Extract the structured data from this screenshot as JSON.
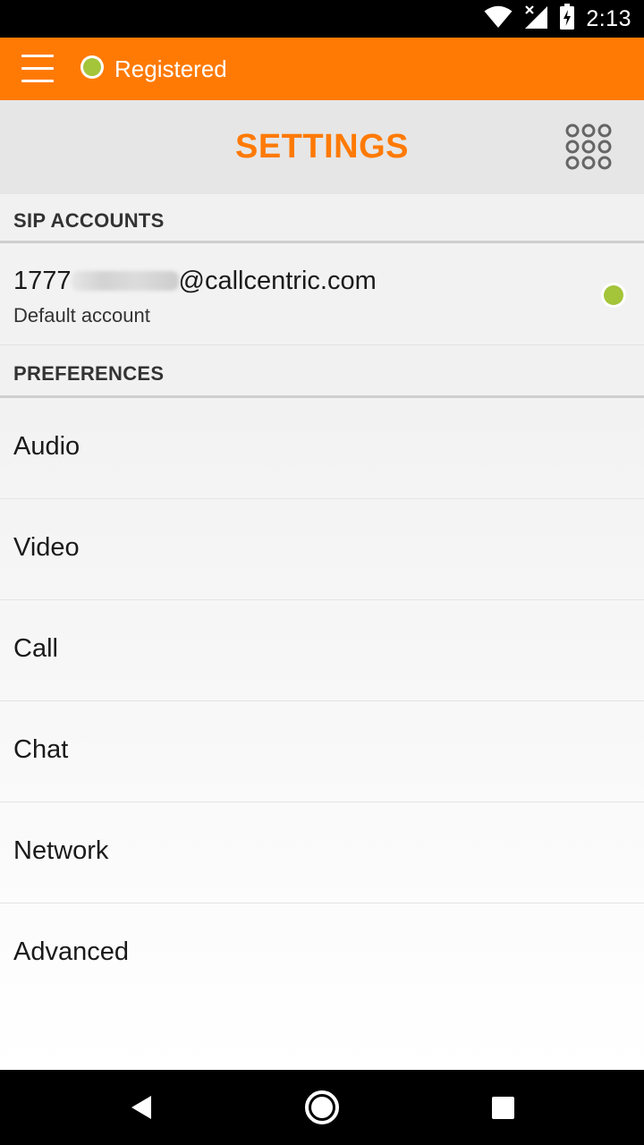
{
  "status_bar": {
    "time": "2:13",
    "icons": [
      "wifi-icon",
      "signal-no-data-icon",
      "battery-charging-icon"
    ]
  },
  "app_bar": {
    "menu_icon": "hamburger-menu-icon",
    "registration_status": "Registered",
    "status_color": "#a4c43a",
    "bar_color": "#ff7a05"
  },
  "title_bar": {
    "title": "SETTINGS",
    "dialpad_icon": "dialpad-icon"
  },
  "sip_accounts": {
    "header": "SIP ACCOUNTS",
    "accounts": [
      {
        "address_prefix": "1777",
        "address_suffix": "@callcentric.com",
        "subtitle": "Default account",
        "status_color": "#a4c43a"
      }
    ]
  },
  "preferences": {
    "header": "PREFERENCES",
    "items": [
      {
        "label": "Audio"
      },
      {
        "label": "Video"
      },
      {
        "label": "Call"
      },
      {
        "label": "Chat"
      },
      {
        "label": "Network"
      },
      {
        "label": "Advanced"
      }
    ]
  },
  "nav_bar": {
    "buttons": [
      "back-icon",
      "home-icon",
      "recents-icon"
    ]
  }
}
